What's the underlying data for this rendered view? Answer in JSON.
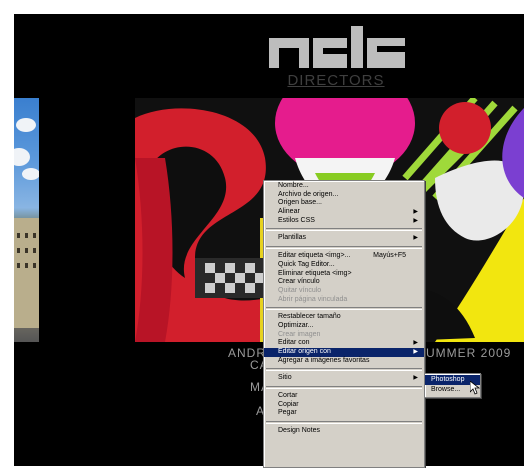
{
  "header": {
    "section_title": "DIRECTORS"
  },
  "captions": {
    "line1_left": "ANDRE",
    "line1_right": "UMMER 2009",
    "line2_left": "CA",
    "line3_left": "MA",
    "line4_left": "A"
  },
  "context_menu": {
    "items": [
      {
        "label": "Nombre...",
        "disabled": false,
        "submenu": false
      },
      {
        "label": "Archivo de origen...",
        "disabled": false,
        "submenu": false
      },
      {
        "label": "Origen base...",
        "disabled": false,
        "submenu": false
      },
      {
        "label": "Alinear",
        "disabled": false,
        "submenu": true
      },
      {
        "label": "Estilos CSS",
        "disabled": false,
        "submenu": true
      },
      {
        "separator": true
      },
      {
        "label": "Plantillas",
        "disabled": false,
        "submenu": true
      },
      {
        "separator": true
      },
      {
        "label": "Editar etiqueta <img>...",
        "shortcut": "Mayús+F5",
        "disabled": false,
        "submenu": false
      },
      {
        "label": "Quick Tag Editor...",
        "disabled": false,
        "submenu": false
      },
      {
        "label": "Eliminar etiqueta <img>",
        "disabled": false,
        "submenu": false
      },
      {
        "label": "Crear vínculo",
        "disabled": false,
        "submenu": false
      },
      {
        "label": "Quitar vínculo",
        "disabled": true,
        "submenu": false
      },
      {
        "label": "Abrir página vinculada",
        "disabled": true,
        "submenu": false
      },
      {
        "separator": true
      },
      {
        "label": "Restablecer tamaño",
        "disabled": false,
        "submenu": false
      },
      {
        "label": "Optimizar...",
        "disabled": false,
        "submenu": false
      },
      {
        "label": "Crear imagen",
        "disabled": true,
        "submenu": false
      },
      {
        "label": "Editar con",
        "disabled": false,
        "submenu": true
      },
      {
        "label": "Editar origen con",
        "disabled": false,
        "submenu": true,
        "highlighted": true
      },
      {
        "label": "Agregar a imágenes favoritas",
        "disabled": false,
        "submenu": false
      },
      {
        "separator": true
      },
      {
        "label": "Sitio",
        "disabled": false,
        "submenu": true
      },
      {
        "separator": true
      },
      {
        "label": "Cortar",
        "disabled": false,
        "submenu": false
      },
      {
        "label": "Copiar",
        "disabled": false,
        "submenu": false
      },
      {
        "label": "Pegar",
        "disabled": false,
        "submenu": false
      },
      {
        "separator": true
      },
      {
        "label": "Design Notes",
        "disabled": false,
        "submenu": false
      }
    ]
  },
  "submenu": {
    "items": [
      {
        "label": "Photoshop",
        "highlighted": true
      },
      {
        "label": "Browse..."
      }
    ]
  },
  "icons": {
    "submenu_arrow": "▶"
  },
  "colors": {
    "menu_bg": "#d4d0c8",
    "highlight": "#0a246a"
  }
}
